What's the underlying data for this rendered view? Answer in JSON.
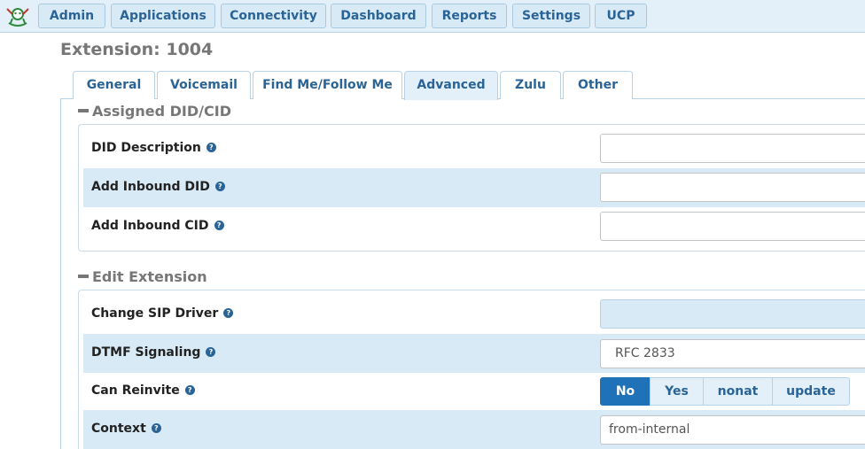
{
  "nav": {
    "items": [
      {
        "label": "Admin"
      },
      {
        "label": "Applications"
      },
      {
        "label": "Connectivity"
      },
      {
        "label": "Dashboard"
      },
      {
        "label": "Reports"
      },
      {
        "label": "Settings"
      },
      {
        "label": "UCP"
      }
    ]
  },
  "page": {
    "title": "Extension: 1004"
  },
  "tabs": [
    {
      "label": "General"
    },
    {
      "label": "Voicemail"
    },
    {
      "label": "Find Me/Follow Me"
    },
    {
      "label": "Advanced",
      "active": true
    },
    {
      "label": "Zulu"
    },
    {
      "label": "Other"
    }
  ],
  "sections": {
    "assigned": {
      "title": "Assigned DID/CID",
      "rows": [
        {
          "label": "DID Description",
          "value": ""
        },
        {
          "label": "Add Inbound DID",
          "value": ""
        },
        {
          "label": "Add Inbound CID",
          "value": ""
        }
      ]
    },
    "edit": {
      "title": "Edit Extension",
      "rows": [
        {
          "label": "Change SIP Driver",
          "value": ""
        },
        {
          "label": "DTMF Signaling",
          "value": "RFC 2833"
        },
        {
          "label": "Can Reinvite",
          "options": [
            "No",
            "Yes",
            "nonat",
            "update"
          ],
          "selected": "No"
        },
        {
          "label": "Context",
          "value": "from-internal"
        }
      ]
    }
  },
  "colors": {
    "accent": "#1f71b8",
    "link": "#2a6496",
    "row_shade": "#d9eaf7"
  }
}
